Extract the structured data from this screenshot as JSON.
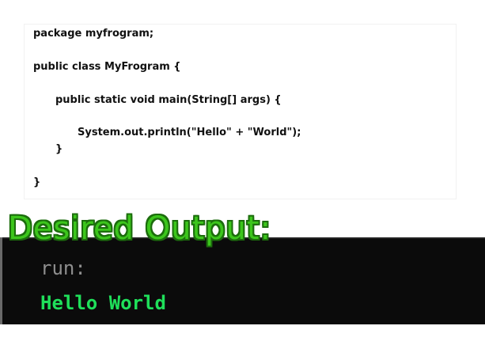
{
  "code": {
    "lines": [
      "package myfrogram;",
      "public class MyFrogram {",
      "public static void main(String[] args) {",
      "System.out.println(\"Hello\" + \"World\");",
      "}",
      "}"
    ]
  },
  "title": "Desired Output:",
  "console": {
    "run_label": "run:",
    "output": "Hello World"
  },
  "colors": {
    "title_green": "#3cc61c",
    "console_bg": "#0b0b0b",
    "console_output": "#1fe05a",
    "console_run": "#8e8e8e"
  }
}
